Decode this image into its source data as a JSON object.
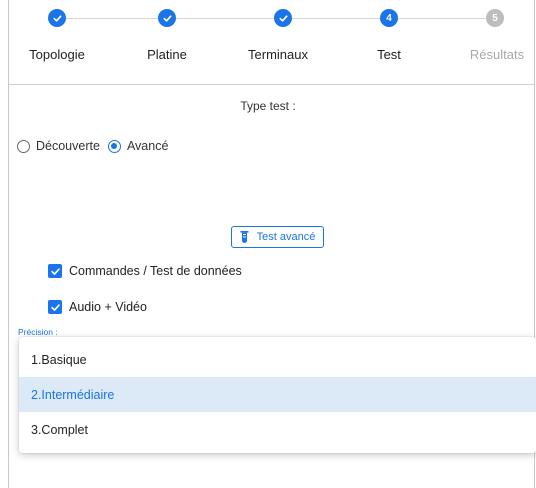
{
  "stepper": {
    "steps": [
      {
        "label": "Topologie",
        "number": "1",
        "status": "done"
      },
      {
        "label": "Platine",
        "number": "2",
        "status": "done"
      },
      {
        "label": "Terminaux",
        "number": "3",
        "status": "done"
      },
      {
        "label": "Test",
        "number": "4",
        "status": "active"
      },
      {
        "label": "Résultats",
        "number": "5",
        "status": "pending"
      }
    ]
  },
  "type_test": {
    "label": "Type test :",
    "options": [
      {
        "label": "Découverte",
        "checked": false
      },
      {
        "label": "Avancé",
        "checked": true
      }
    ]
  },
  "advanced_button": {
    "label": "Test avancé",
    "icon": "test-tube-icon"
  },
  "checkboxes": [
    {
      "label": "Commandes / Test de données",
      "checked": true
    },
    {
      "label": "Audio + Vidéo",
      "checked": true
    }
  ],
  "precision": {
    "label": "Précision :",
    "selected": "2.Intermédiaire",
    "options": [
      "1.Basique",
      "2.Intermédiaire",
      "3.Complet"
    ]
  },
  "colors": {
    "accent": "#1b74e8",
    "pending": "#bdbdbd",
    "selected_bg": "#dce9f7"
  }
}
